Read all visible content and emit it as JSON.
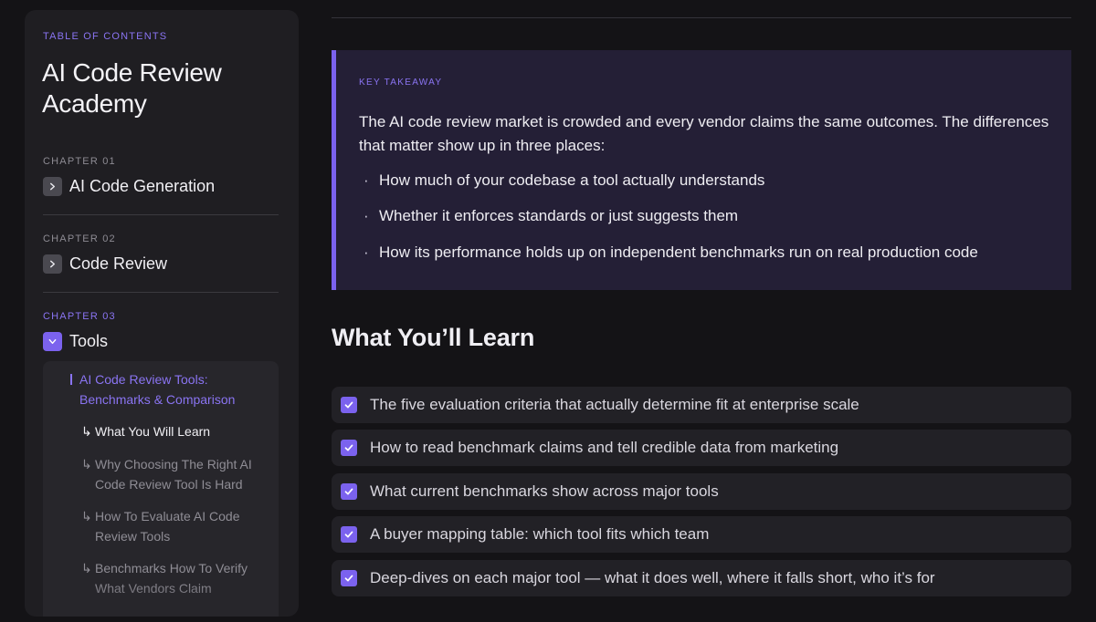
{
  "sidebar": {
    "toc_label": "TABLE OF CONTENTS",
    "title": "AI Code Review Academy",
    "chapters": [
      {
        "number": "CHAPTER 01",
        "name": "AI Code Generation",
        "expanded": false
      },
      {
        "number": "CHAPTER 02",
        "name": "Code Review",
        "expanded": false
      },
      {
        "number": "CHAPTER 03",
        "name": "Tools",
        "expanded": true
      }
    ],
    "active_section": "AI Code Review Tools: Benchmarks & Comparison",
    "subsections": [
      {
        "arrow": "↳",
        "label": "What You Will Learn",
        "current": true
      },
      {
        "arrow": "↳",
        "label": "Why Choosing The Right AI Code Review Tool Is Hard",
        "current": false
      },
      {
        "arrow": "↳",
        "label": "How To Evaluate AI Code Review Tools",
        "current": false
      },
      {
        "arrow": "↳",
        "label": "Benchmarks How To Verify What Vendors Claim",
        "current": false
      }
    ]
  },
  "takeaway": {
    "label": "KEY TAKEAWAY",
    "text": "The AI code review market is crowded and every vendor claims the same outcomes. The differences that matter show up in three places:",
    "bullets": [
      "How much of your codebase a tool actually understands",
      "Whether it enforces standards or just suggests them",
      "How its performance holds up on independent benchmarks run on real production code"
    ]
  },
  "learn": {
    "title": "What You’ll Learn",
    "items": [
      "The five evaluation criteria that actually determine fit at enterprise scale",
      "How to read benchmark claims and tell credible data from marketing",
      "What current benchmarks show across major tools",
      "A buyer mapping table: which tool fits which team",
      "Deep-dives on each major tool — what it does well, where it falls short, who it’s for"
    ]
  },
  "colors": {
    "accent": "#7b62ee",
    "accent_text": "#8a74f2",
    "background": "#141316",
    "panel": "#1f1e22",
    "takeaway_bg": "#241f36"
  },
  "icons": {
    "chapter_collapsed": "chevron-right-icon",
    "chapter_expanded": "chevron-down-icon",
    "learn_item": "check-icon"
  }
}
